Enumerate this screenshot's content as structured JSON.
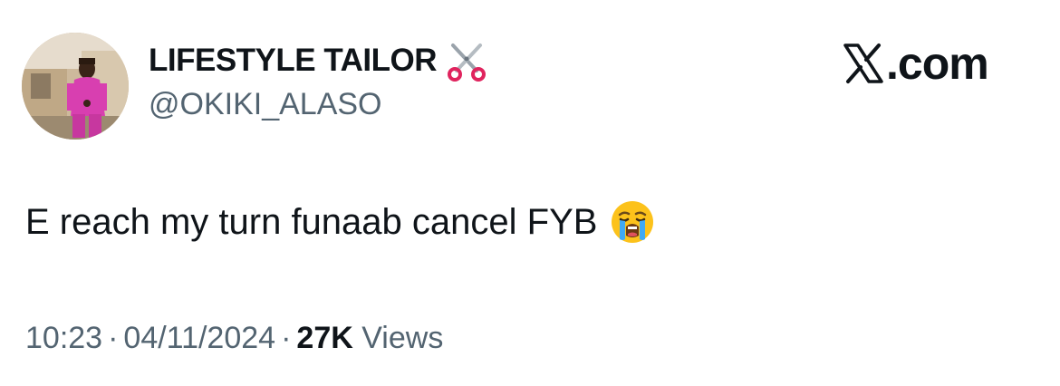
{
  "author": {
    "display_name": "LIFESTYLE TAILOR",
    "handle": "@OKIKI_ALASO",
    "name_emoji": "scissors-icon"
  },
  "brand": {
    "text": ".com",
    "logo": "x-logo-icon"
  },
  "tweet": {
    "text": "E reach my turn funaab cancel FYB",
    "emoji": "loudly-crying-face-icon"
  },
  "meta": {
    "time": "10:23",
    "separator": "·",
    "date": "04/11/2024",
    "views_count": "27K",
    "views_label": "Views"
  },
  "colors": {
    "text_primary": "#0f1419",
    "text_secondary": "#536471",
    "outfit": "#d83fb0"
  }
}
